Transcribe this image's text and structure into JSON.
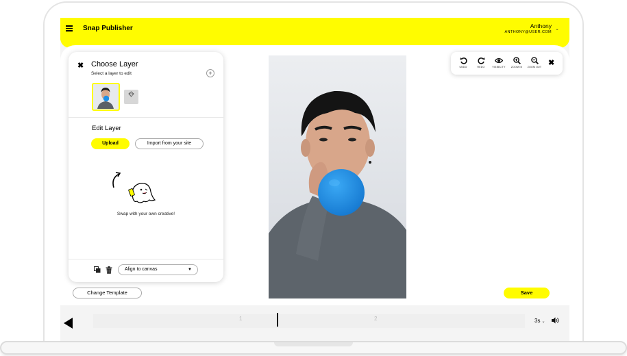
{
  "header": {
    "app_title": "Snap Publisher",
    "user_name": "Anthony",
    "user_email": "ANTHONY@USER.COM"
  },
  "panel": {
    "title": "Choose Layer",
    "subtitle": "Select a layer to edit",
    "edit_title": "Edit Layer",
    "upload_label": "Upload",
    "import_label": "Import from your site",
    "swap_text": "Swap with your own creative!",
    "align_value": "Align to canvas"
  },
  "toolbar": {
    "undo": "UNDO",
    "redo": "REDO",
    "visibility": "VISIBILITY",
    "zoom_in": "ZOOM IN",
    "zoom_out": "ZOOM OUT"
  },
  "buttons": {
    "change_template": "Change Template",
    "save": "Save"
  },
  "timeline": {
    "marker_1": "1",
    "marker_2": "2",
    "duration": "3s"
  },
  "colors": {
    "brand_yellow": "#fffc00",
    "balloon_blue": "#1e90e8"
  },
  "icons": [
    "menu-icon",
    "chevron-down-icon",
    "close-icon",
    "plus-icon",
    "undo-icon",
    "redo-icon",
    "eye-icon",
    "zoom-in-icon",
    "zoom-out-icon",
    "play-icon",
    "duplicate-icon",
    "trash-icon",
    "volume-icon"
  ]
}
